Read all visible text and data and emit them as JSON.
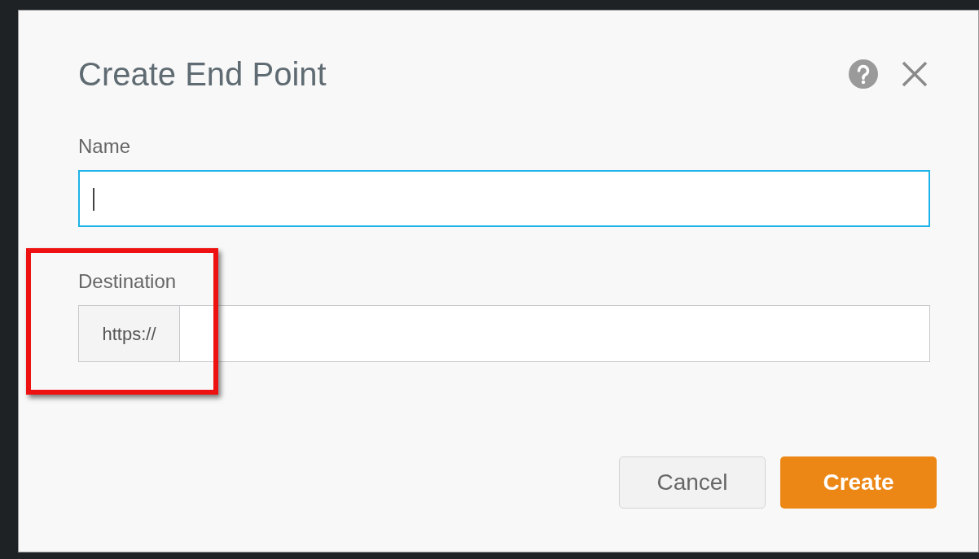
{
  "dialog": {
    "title": "Create End Point"
  },
  "fields": [
    {
      "kind": "text",
      "label": "Name",
      "focused": true
    },
    {
      "kind": "prefixed",
      "label": "Destination",
      "prefix": "https://",
      "focused": false
    }
  ],
  "buttons": [
    {
      "kind": "secondary",
      "label": "Cancel"
    },
    {
      "kind": "primary",
      "label": "Create"
    }
  ]
}
